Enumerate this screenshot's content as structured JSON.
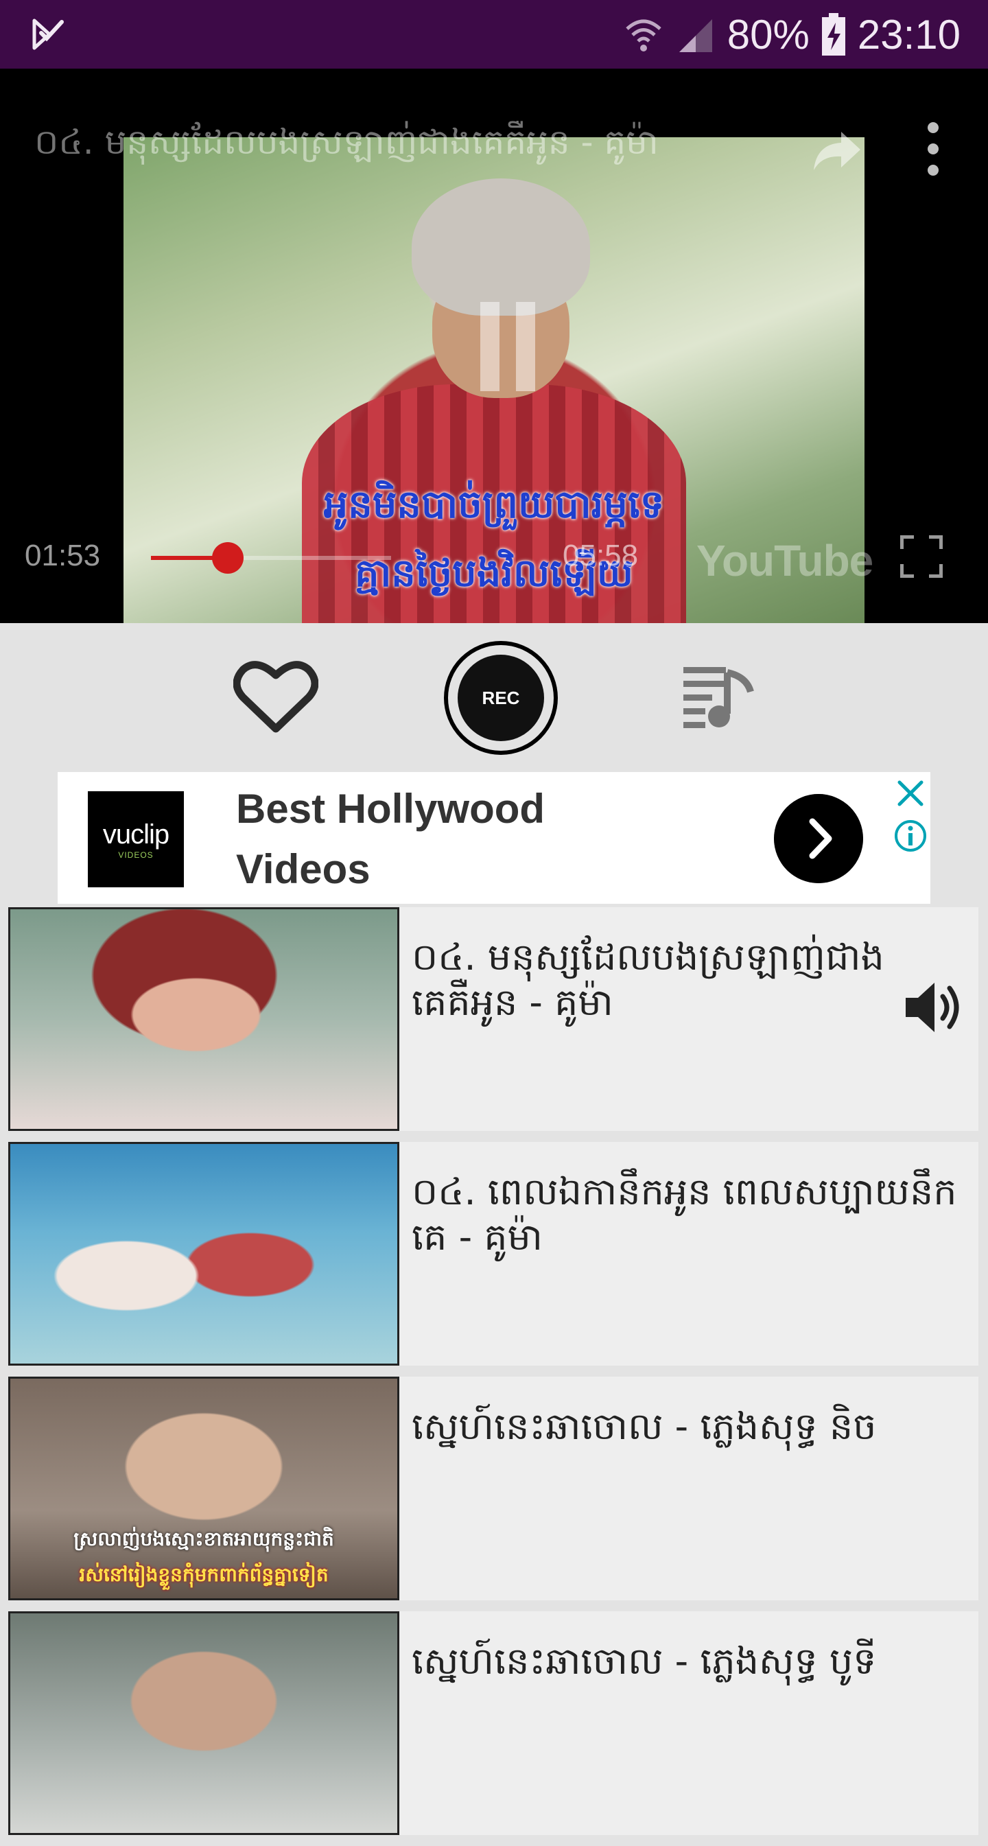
{
  "status_bar": {
    "battery": "80%",
    "time": "23:10"
  },
  "player": {
    "title": "០៤. មនុស្សដែលបងស្រឡាញ់ជាងគេគឺអូន - គូម៉ា",
    "subtitle_line1": "អូនមិនបាច់ព្រួយបារម្ភទេ",
    "subtitle_line2": "គ្មានថ្ងៃបងវិលឡើយ",
    "current_time": "01:53",
    "duration": "05:58",
    "progress_fraction": 0.32,
    "watermark": "YouTube",
    "accent_color": "#d11c1c"
  },
  "controls": {
    "rec_label": "REC"
  },
  "ad": {
    "logo_text": "vuclip",
    "logo_subtext": "VIDEOS",
    "headline": "Best Hollywood Videos",
    "accent_color": "#00a3b4"
  },
  "playlist": [
    {
      "title": "០៤. មនុស្សដែលបងស្រឡាញ់ជាងគេគឺអូន - គូម៉ា",
      "now_playing": true
    },
    {
      "title": "០៤. ពេលឯកានឹកអូន ពេលសប្បាយនឹកគេ - គូម៉ា",
      "now_playing": false
    },
    {
      "title": "ស្នេហ៍នេះឆាចោល - ភ្លេងសុទ្ធ និច",
      "now_playing": false,
      "thumb_caption1": "ស្រលាញ់បងស្មោះខាតអាយុកន្លះជាតិ",
      "thumb_caption2": "រស់នៅរៀងខ្លួនកុំមកពាក់ព័ន្ធគ្នាទៀត"
    },
    {
      "title": "ស្នេហ៍នេះឆាចោល - ភ្លេងសុទ្ធ បូទី",
      "now_playing": false
    }
  ]
}
